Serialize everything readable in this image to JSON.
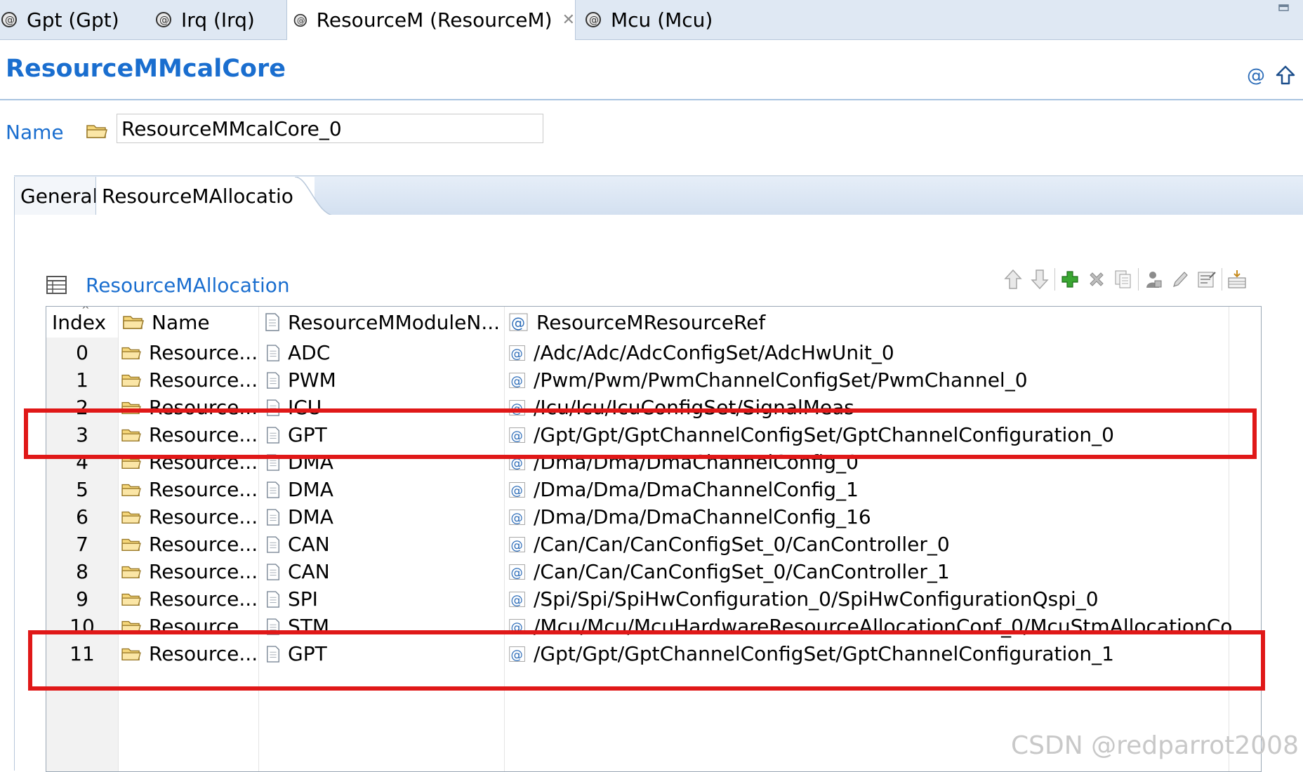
{
  "editor_tabs": [
    {
      "label": "Gpt (Gpt)",
      "active": false
    },
    {
      "label": "Irq (Irq)",
      "active": false
    },
    {
      "label": "ResourceM (ResourceM)",
      "active": true,
      "close_icon": "close-icon"
    },
    {
      "label": "Mcu (Mcu)",
      "active": false
    }
  ],
  "header": {
    "title": "ResourceMMcalCore",
    "icons": [
      "at-reference-icon",
      "go-up-arrow-icon"
    ]
  },
  "name_field": {
    "label": "Name",
    "value": "ResourceMMcalCore_0"
  },
  "page_tabs": [
    "General",
    "ResourceMAllocation"
  ],
  "section": {
    "title": "ResourceMAllocation",
    "toolbar": [
      "move-up-icon",
      "move-down-icon",
      "add-icon",
      "delete-icon",
      "copy-icon",
      "user-icon",
      "edit-icon",
      "properties-icon",
      "insert-icon"
    ]
  },
  "table": {
    "columns": [
      "Index",
      "Name",
      "ResourceMModuleN...",
      "ResourceMResourceRef"
    ],
    "rows": [
      {
        "index": "0",
        "name": "Resource...",
        "module": "ADC",
        "ref": "/Adc/Adc/AdcConfigSet/AdcHwUnit_0"
      },
      {
        "index": "1",
        "name": "Resource...",
        "module": "PWM",
        "ref": "/Pwm/Pwm/PwmChannelConfigSet/PwmChannel_0"
      },
      {
        "index": "2",
        "name": "Resource...",
        "module": "ICU",
        "ref": "/Icu/Icu/IcuConfigSet/SignalMeas"
      },
      {
        "index": "3",
        "name": "Resource...",
        "module": "GPT",
        "ref": "/Gpt/Gpt/GptChannelConfigSet/GptChannelConfiguration_0"
      },
      {
        "index": "4",
        "name": "Resource...",
        "module": "DMA",
        "ref": "/Dma/Dma/DmaChannelConfig_0"
      },
      {
        "index": "5",
        "name": "Resource...",
        "module": "DMA",
        "ref": "/Dma/Dma/DmaChannelConfig_1"
      },
      {
        "index": "6",
        "name": "Resource...",
        "module": "DMA",
        "ref": "/Dma/Dma/DmaChannelConfig_16"
      },
      {
        "index": "7",
        "name": "Resource...",
        "module": "CAN",
        "ref": "/Can/Can/CanConfigSet_0/CanController_0"
      },
      {
        "index": "8",
        "name": "Resource...",
        "module": "CAN",
        "ref": "/Can/Can/CanConfigSet_0/CanController_1"
      },
      {
        "index": "9",
        "name": "Resource...",
        "module": "SPI",
        "ref": "/Spi/Spi/SpiHwConfiguration_0/SpiHwConfigurationQspi_0"
      },
      {
        "index": "10",
        "name": "Resource...",
        "module": "STM",
        "ref": "/Mcu/Mcu/McuHardwareResourceAllocationConf_0/McuStmAllocationCo"
      },
      {
        "index": "11",
        "name": "Resource...",
        "module": "GPT",
        "ref": "/Gpt/Gpt/GptChannelConfigSet/GptChannelConfiguration_1"
      }
    ]
  },
  "highlight_color": "#e01818",
  "accent_color": "#1a6ecf",
  "watermark": "CSDN @redparrot2008"
}
